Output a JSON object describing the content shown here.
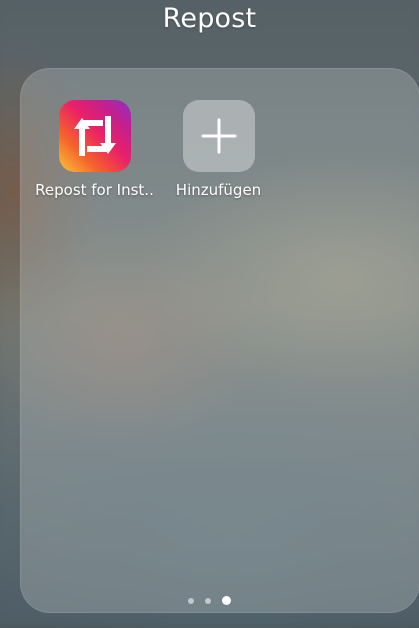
{
  "folder": {
    "title": "Repost",
    "apps": [
      {
        "label": "Repost for Inst..",
        "icon": "repost-icon"
      },
      {
        "label": "Hinzufügen",
        "icon": "plus-icon"
      }
    ]
  },
  "page_indicator": {
    "pages": 3,
    "current": 3
  },
  "colors": {
    "repost_gradient": [
      "#f9c638",
      "#f6632b",
      "#ea2166",
      "#c41f8e",
      "#8c31c6"
    ],
    "text": "#ffffff"
  }
}
